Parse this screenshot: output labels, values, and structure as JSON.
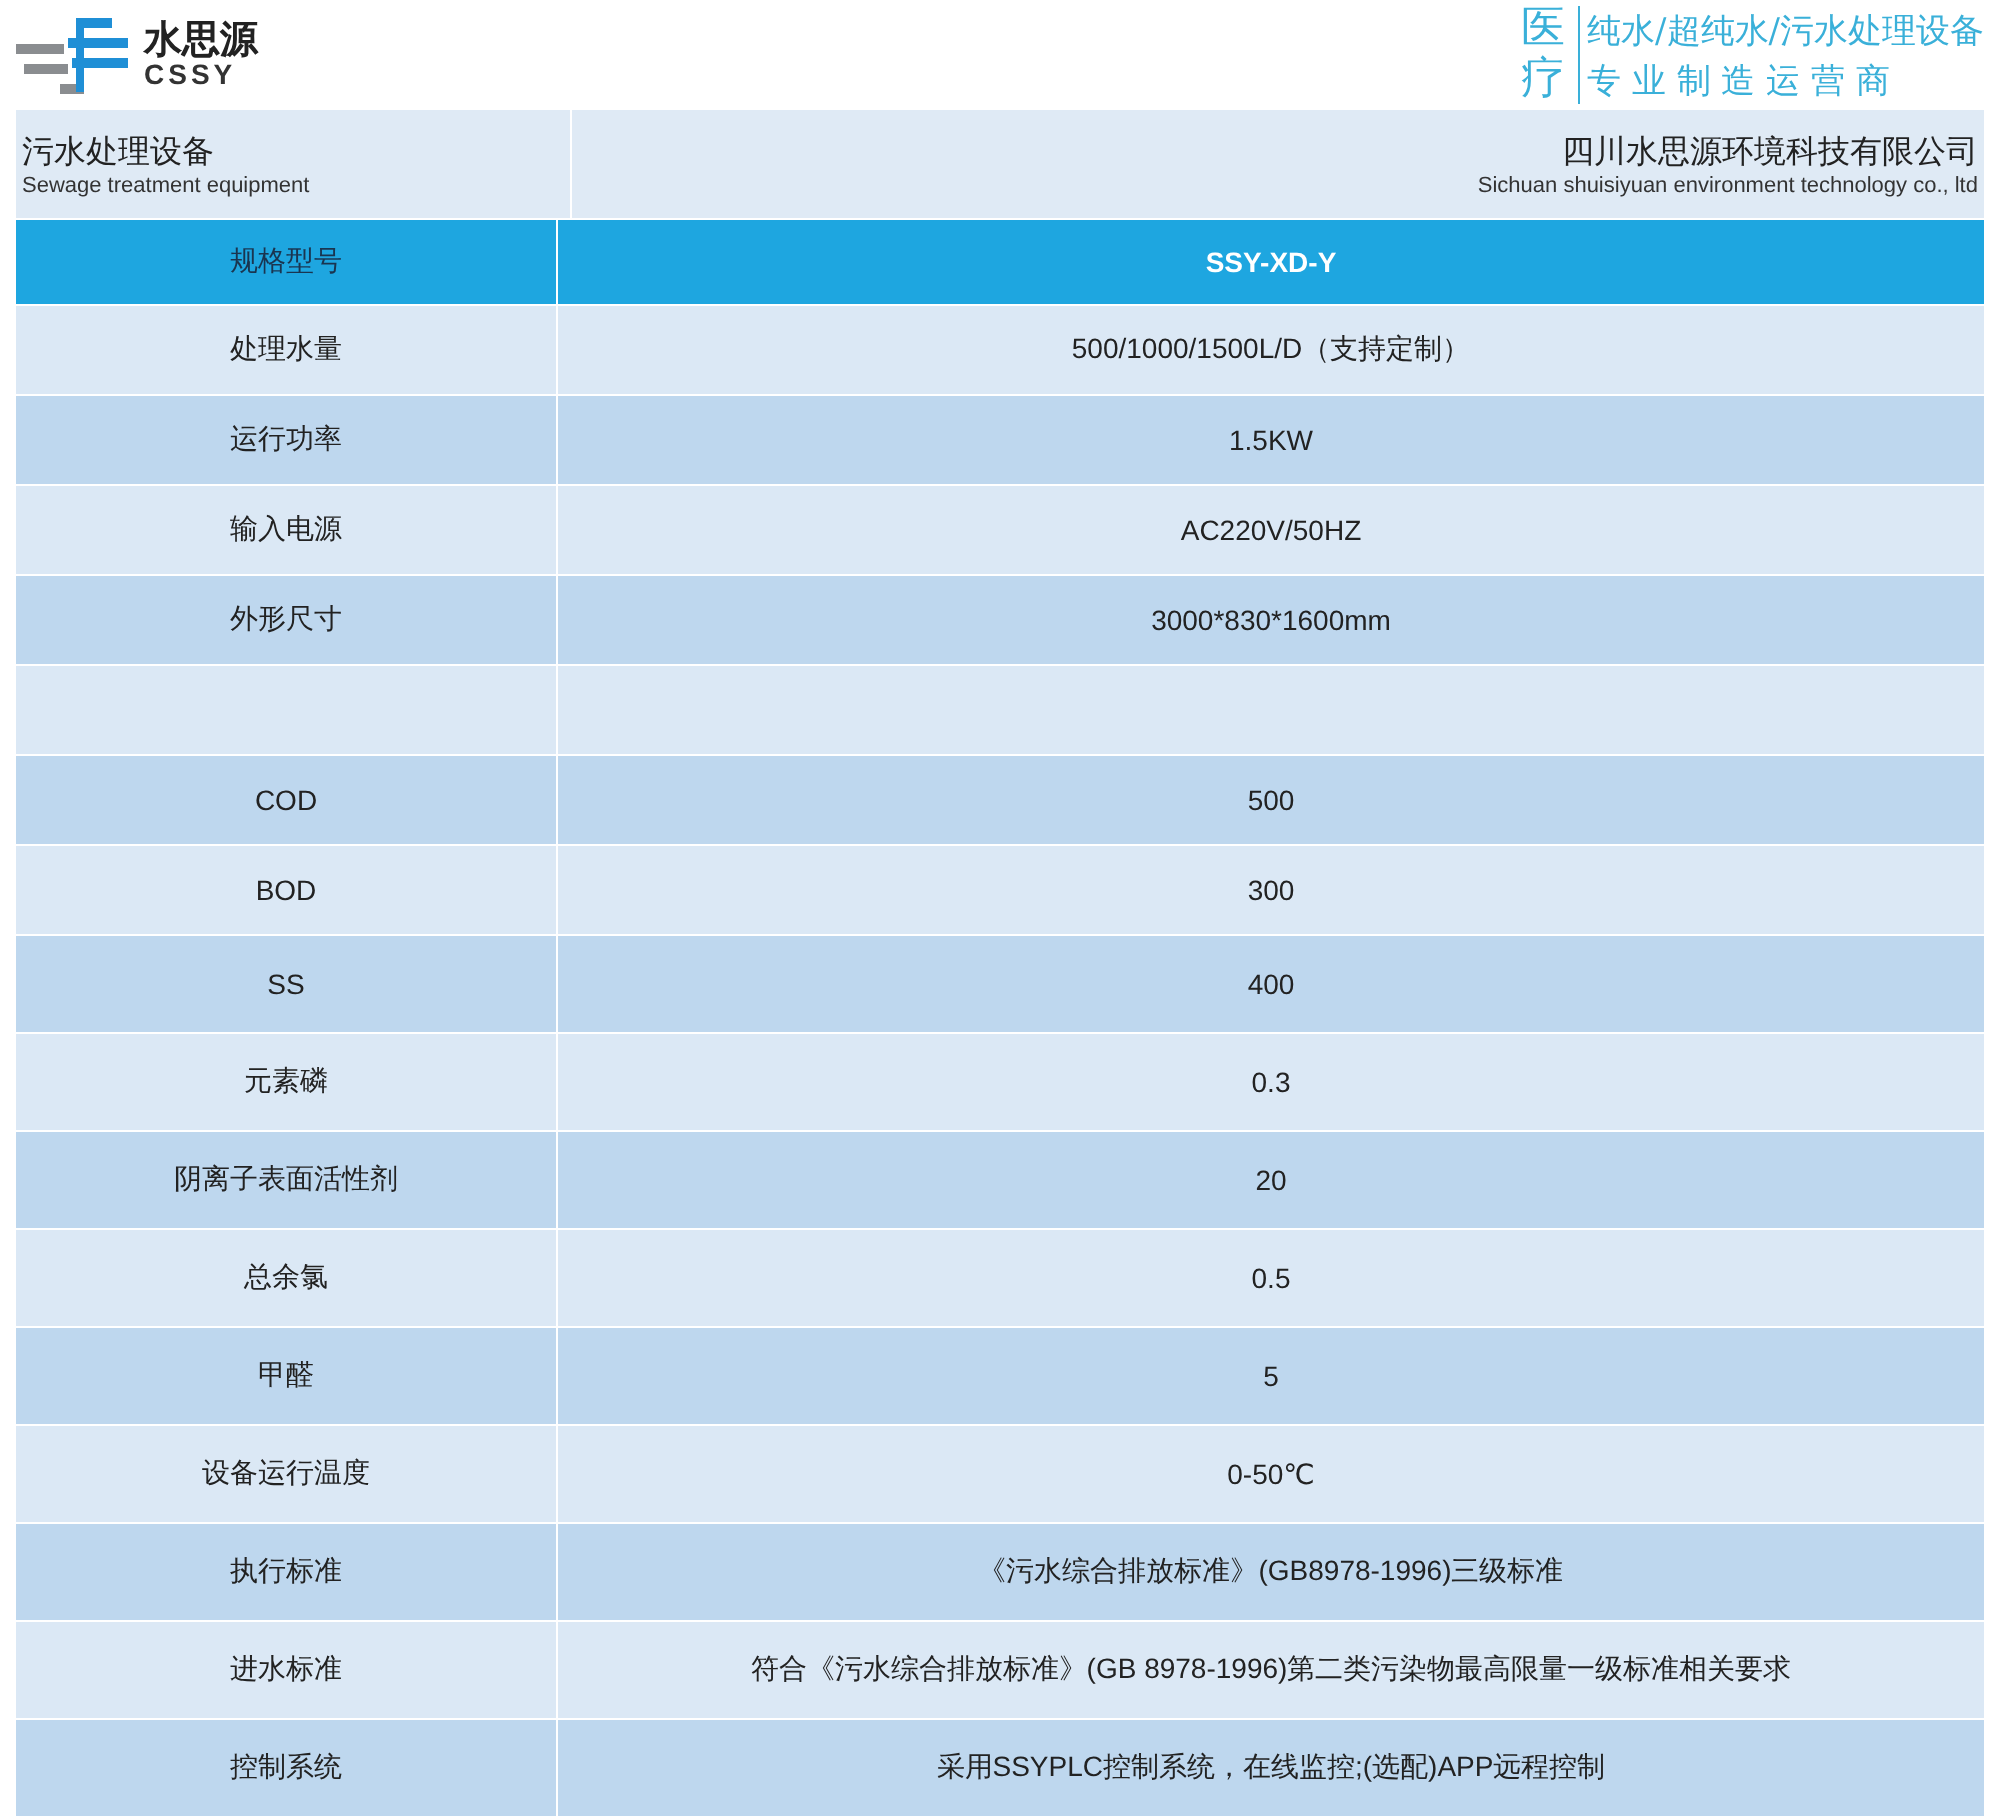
{
  "logo": {
    "name": "水思源",
    "latin": "CSSY"
  },
  "slogan": {
    "mark": "医疗",
    "lines": [
      "纯水/超纯水/污水处理设备",
      "专 业 制 造 运 营 商"
    ]
  },
  "title_band": {
    "product": "污水处理设备",
    "product_en": "Sewage treatment equipment",
    "company": "四川水思源环境科技有限公司",
    "company_en": "Sichuan shuisiyuan environment technology co., ltd"
  },
  "table": {
    "header": {
      "label": "规格型号",
      "value": "SSY-XD-Y"
    },
    "rows": [
      {
        "label": "处理水量",
        "value": "500/1000/1500L/D（支持定制）"
      },
      {
        "label": "运行功率",
        "value": "1.5KW"
      },
      {
        "label": "输入电源",
        "value": "AC220V/50HZ"
      },
      {
        "label": "外形尺寸",
        "value": "3000*830*1600mm"
      },
      {},
      {
        "label": "COD",
        "value": "500"
      },
      {
        "label": "BOD",
        "value": "300"
      },
      {
        "label": "SS",
        "value": "400"
      },
      {
        "label": "元素磷",
        "value": "0.3"
      },
      {
        "label": "阴离子表面活性剂",
        "value": "20"
      },
      {
        "label": "总余氯",
        "value": "0.5"
      },
      {
        "label": "甲醛",
        "value": "5"
      },
      {
        "label": "设备运行温度",
        "value": "0-50℃"
      },
      {
        "label": "执行标准",
        "value": "《污水综合排放标准》(GB8978-1996)三级标准"
      },
      {
        "label": "进水标准",
        "value": "符合《污水综合排放标准》(GB 8978-1996)第二类污染物最高限量一级标准相关要求"
      },
      {
        "label": "控制系统",
        "value": "采用SSYPLC控制系统，在线监控;(选配)APP远程控制"
      }
    ]
  }
}
